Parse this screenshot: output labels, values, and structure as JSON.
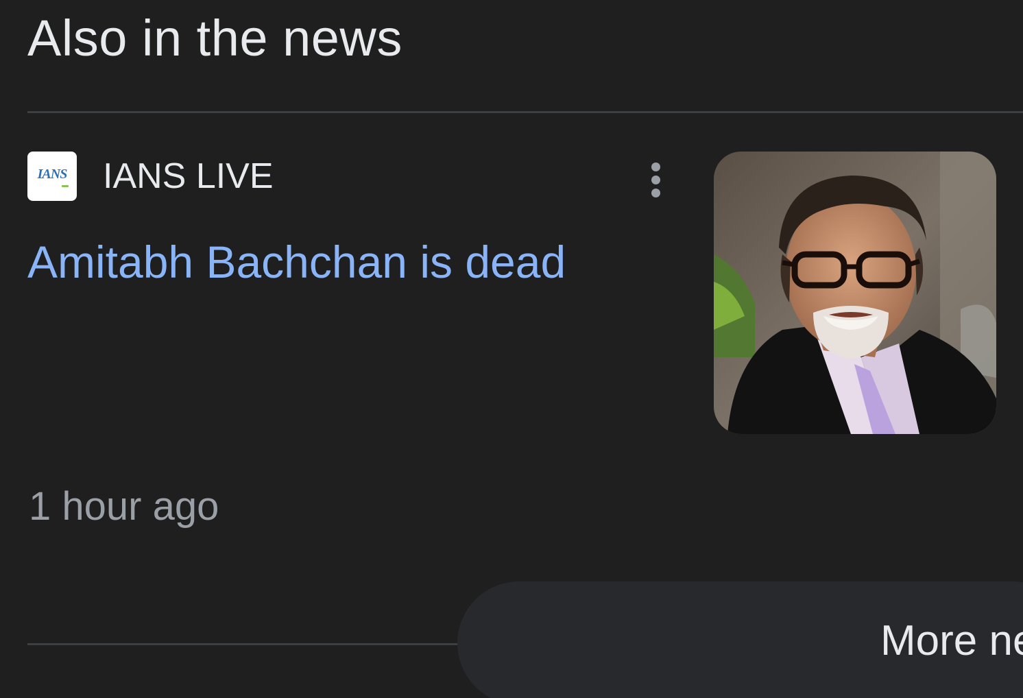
{
  "section": {
    "title": "Also in the news"
  },
  "article": {
    "source": {
      "name": "IANS LIVE",
      "logo_text": "IANS",
      "logo_icon": "ians-logo-icon"
    },
    "menu_icon": "more-vert-icon",
    "headline": "Amitabh Bachchan is dead",
    "timestamp": "1 hour ago",
    "thumbnail_alt": "Amitabh Bachchan"
  },
  "footer": {
    "more_news_label": "More news"
  },
  "colors": {
    "background": "#1f1f1f",
    "headline_link": "#8ab4f8",
    "primary_text": "#e8eaed",
    "secondary_text": "#9aa0a6",
    "divider": "#3c4043",
    "button_bg": "#28292c"
  }
}
